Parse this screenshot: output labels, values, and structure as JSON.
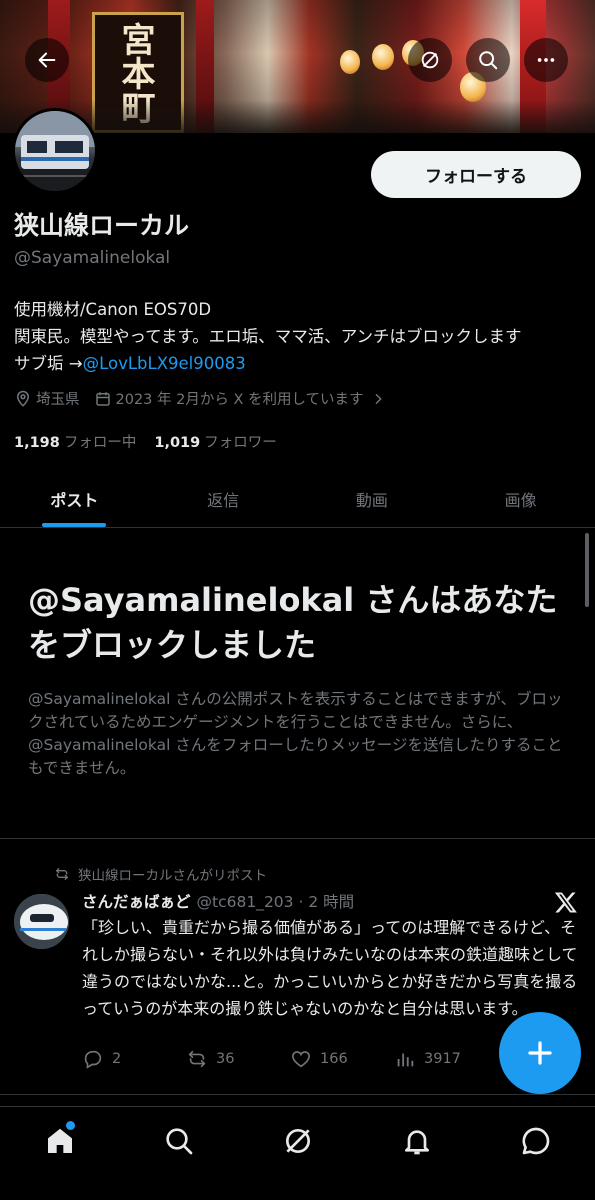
{
  "profile": {
    "display_name": "狭山線ローカル",
    "handle": "@Sayamalinelokal",
    "follow_label": "フォローする",
    "bio_line1": "使用機材/Canon EOS70D",
    "bio_line2": "関東民。模型やってます。エロ垢、ママ活、アンチはブロックします",
    "bio_line3_prefix": "サブ垢 →",
    "bio_line3_link": "@LovLbLX9el90083",
    "location": "埼玉県",
    "joined": "2023 年 2月から X を利用しています",
    "following_count": "1,198",
    "following_label": "フォロー中",
    "followers_count": "1,019",
    "followers_label": "フォロワー"
  },
  "banner": {
    "sign_text": "宮本町"
  },
  "tabs": [
    {
      "label": "ポスト",
      "active": true
    },
    {
      "label": "返信",
      "active": false
    },
    {
      "label": "動画",
      "active": false
    },
    {
      "label": "画像",
      "active": false
    }
  ],
  "blocked": {
    "title": "@Sayamalinelokal さんはあなたをブロックしました",
    "description": "@Sayamalinelokal さんの公開ポストを表示することはできますが、ブロックされているためエンゲージメントを行うことはできません。さらに、@Sayamalinelokal さんをフォローしたりメッセージを送信したりすることもできません。"
  },
  "tweet": {
    "repost_label": "狭山線ローカルさんがリポスト",
    "display_name": "さんだぁばぁど",
    "handle_time": "@tc681_203 · 2 時間",
    "text": "「珍しい、貴重だから撮る価値がある」ってのは理解できるけど、それしか撮らない・それ以外は負けみたいなのは本来の鉄道趣味として違うのではないかな...と。かっこいいからとか好きだから写真を撮るっていうのが本来の撮り鉄じゃないのかなと自分は思います。",
    "replies": "2",
    "reposts": "36",
    "likes": "166",
    "views": "3917"
  },
  "colors": {
    "accent": "#1d9bf0",
    "text_primary": "#e7e9ea",
    "text_secondary": "#71767b",
    "divider": "#2f3336"
  },
  "icons": {
    "top_bar": [
      "back-arrow-icon",
      "grok-icon",
      "search-icon",
      "more-icon"
    ],
    "bottom_nav": [
      "home-icon",
      "search-icon",
      "grok-icon",
      "notifications-icon",
      "messages-icon"
    ]
  }
}
